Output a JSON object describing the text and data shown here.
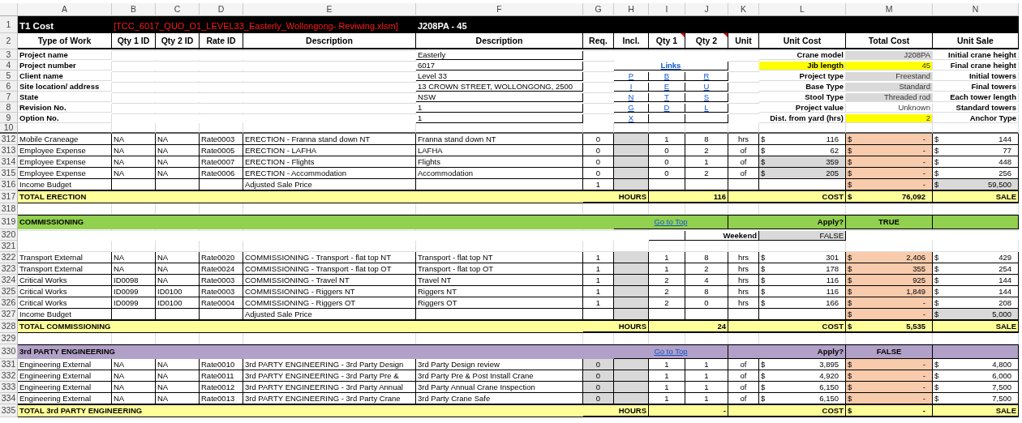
{
  "column_headers": [
    "A",
    "B",
    "C",
    "D",
    "E",
    "F",
    "G",
    "H",
    "I",
    "J",
    "K",
    "L",
    "M",
    "N"
  ],
  "title_row": {
    "row": "1",
    "label": "T1 Cost",
    "file": "[TCC_6017_QUO_O1_LEVEL33_Easterly_Wollongong- Reviwing.xlsm]",
    "model": "J208PA - 45"
  },
  "heading_row": {
    "row": "2",
    "headings": [
      {
        "text": "Type of Work",
        "comment": false
      },
      {
        "text": "Qty 1 ID",
        "comment": false
      },
      {
        "text": "Qty 2 ID",
        "comment": false
      },
      {
        "text": "Rate ID",
        "comment": false
      },
      {
        "text": "Description",
        "comment": false
      },
      {
        "text": "Description",
        "comment": false
      },
      {
        "text": "Req.",
        "comment": false
      },
      {
        "text": "Incl.",
        "comment": false
      },
      {
        "text": "Qty 1",
        "comment": true
      },
      {
        "text": "Qty 2",
        "comment": true
      },
      {
        "text": "Unit",
        "comment": false
      },
      {
        "text": "Unit Cost",
        "comment": false
      },
      {
        "text": "Total Cost",
        "comment": false
      },
      {
        "text": "Unit Sale",
        "comment": false
      }
    ]
  },
  "rows": [
    {
      "row": "3",
      "kind": "info",
      "label": "Project name",
      "value": "Easterly",
      "setting": "Crane model",
      "setting_highlight": false,
      "setting_value": "J208PA",
      "value_highlight": false,
      "value_locked": true,
      "tower": "Initial crane height"
    },
    {
      "row": "4",
      "kind": "info",
      "label": "Project number",
      "value": "6017",
      "links_heading": "Links",
      "setting": "Jib length",
      "setting_highlight": true,
      "setting_value": "45",
      "value_highlight": true,
      "value_locked": false,
      "tower": "Final crane height"
    },
    {
      "row": "5",
      "kind": "info",
      "label": "Client name",
      "value": "Level 33",
      "links": [
        "P",
        "B",
        "R"
      ],
      "setting": "Project type",
      "setting_highlight": false,
      "setting_value": "Freestand",
      "value_highlight": false,
      "value_locked": true,
      "tower": "Initial towers"
    },
    {
      "row": "6",
      "kind": "info",
      "label": "Site location/ address",
      "value": "13 CROWN STREET, WOLLONGONG, 2500",
      "links": [
        "I",
        "E",
        "U"
      ],
      "setting": "Base Type",
      "setting_highlight": false,
      "setting_value": "Standard",
      "value_highlight": false,
      "value_locked": true,
      "tower": "Final towers"
    },
    {
      "row": "7",
      "kind": "info",
      "label": "State",
      "value": "NSW",
      "links": [
        "N",
        "T",
        "S"
      ],
      "setting": "Stool Type",
      "setting_highlight": false,
      "setting_value": "Threaded rod",
      "value_highlight": false,
      "value_locked": true,
      "tower": "Each tower length"
    },
    {
      "row": "8",
      "kind": "info",
      "label": "Revision No.",
      "value": "1",
      "links": [
        "G",
        "D",
        "L"
      ],
      "setting": "Project value",
      "setting_highlight": false,
      "setting_value": "Unknown",
      "value_highlight": false,
      "value_locked": false,
      "tower": "Standard towers"
    },
    {
      "row": "9",
      "kind": "info",
      "label": "Option No.",
      "value": "1",
      "links": [
        "X"
      ],
      "setting": "Dist. from yard (hrs)",
      "setting_highlight": false,
      "setting_value": "2",
      "value_highlight": true,
      "value_locked": false,
      "tower": "Anchor Type"
    },
    {
      "row": "10",
      "kind": "freeze"
    },
    {
      "row": "312",
      "kind": "data",
      "type": "Mobile Craneage",
      "qty1_id": "NA",
      "qty2_id": "NA",
      "rate_id": "Rate0003",
      "description": "ERECTION - Franna stand down NT",
      "detail": "Franna stand down NT",
      "req": "0",
      "req_shaded": false,
      "qty1": "1",
      "qty2": "8",
      "unit": "hrs",
      "unit_cost": {
        "currency": "$",
        "amount": "116",
        "shaded": false
      },
      "total_cost": {
        "currency": "$",
        "amount": "-"
      },
      "unit_sale": {
        "currency": "$",
        "amount": "144",
        "shaded": false
      }
    },
    {
      "row": "313",
      "kind": "data",
      "type": "Employee Expense",
      "qty1_id": "NA",
      "qty2_id": "NA",
      "rate_id": "Rate0005",
      "description": "ERECTION - LAFHA",
      "detail": "LAFHA",
      "req": "0",
      "req_shaded": false,
      "qty1": "0",
      "qty2": "2",
      "unit": "of",
      "unit_cost": {
        "currency": "$",
        "amount": "62",
        "shaded": false
      },
      "total_cost": {
        "currency": "$",
        "amount": "-"
      },
      "unit_sale": {
        "currency": "$",
        "amount": "77",
        "shaded": false
      }
    },
    {
      "row": "314",
      "kind": "data",
      "type": "Employee Expense",
      "qty1_id": "NA",
      "qty2_id": "NA",
      "rate_id": "Rate0007",
      "description": "ERECTION - Flights",
      "detail": "Flights",
      "req": "0",
      "req_shaded": false,
      "qty1": "0",
      "qty2": "1",
      "unit": "of",
      "unit_cost": {
        "currency": "$",
        "amount": "359",
        "shaded": true
      },
      "total_cost": {
        "currency": "$",
        "amount": "-"
      },
      "unit_sale": {
        "currency": "$",
        "amount": "448",
        "shaded": false
      }
    },
    {
      "row": "315",
      "kind": "data",
      "type": "Employee Expense",
      "qty1_id": "NA",
      "qty2_id": "NA",
      "rate_id": "Rate0006",
      "description": "ERECTION - Accommodation",
      "detail": "Accommodation",
      "req": "0",
      "req_shaded": false,
      "qty1": "0",
      "qty2": "2",
      "unit": "of",
      "unit_cost": {
        "currency": "$",
        "amount": "205",
        "shaded": true
      },
      "total_cost": {
        "currency": "$",
        "amount": "-"
      },
      "unit_sale": {
        "currency": "$",
        "amount": "256",
        "shaded": false
      }
    },
    {
      "row": "316",
      "kind": "income",
      "type": "Income Budget",
      "description": "Adjusted Sale Price",
      "req": "1",
      "total_cost": {
        "currency": "$",
        "amount": "-"
      },
      "unit_sale": {
        "currency": "$",
        "amount": "59,500",
        "shaded": true
      }
    },
    {
      "row": "317",
      "kind": "total",
      "label": "TOTAL ERECTION",
      "hours_label": "HOURS",
      "hours": "116",
      "cost_label": "COST",
      "total_cost": {
        "currency": "$",
        "amount": "76,092"
      },
      "sale_label": "SALE"
    },
    {
      "row": "318",
      "kind": "blank"
    },
    {
      "row": "319",
      "kind": "section",
      "label": "COMMISSIONING",
      "color": "#92d050",
      "link": "Go to Top",
      "apply_label": "Apply?",
      "apply_value": "TRUE"
    },
    {
      "row": "320",
      "kind": "weekend",
      "label": "Weekend",
      "value": "FALSE"
    },
    {
      "row": "321",
      "kind": "blank"
    },
    {
      "row": "322",
      "kind": "data",
      "type": "Transport External",
      "qty1_id": "NA",
      "qty2_id": "NA",
      "rate_id": "Rate0020",
      "description": "COMMISSIONING - Transport - flat top NT",
      "detail": "Transport - flat top NT",
      "req": "1",
      "req_shaded": false,
      "qty1": "1",
      "qty2": "8",
      "unit": "hrs",
      "unit_cost": {
        "currency": "$",
        "amount": "301",
        "shaded": false
      },
      "total_cost": {
        "currency": "$",
        "amount": "2,406"
      },
      "unit_sale": {
        "currency": "$",
        "amount": "429",
        "shaded": false
      }
    },
    {
      "row": "323",
      "kind": "data",
      "type": "Transport External",
      "qty1_id": "NA",
      "qty2_id": "NA",
      "rate_id": "Rate0024",
      "description": "COMMISSIONING - Transport - flat top OT",
      "detail": "Transport - flat top OT",
      "req": "1",
      "req_shaded": false,
      "qty1": "1",
      "qty2": "2",
      "unit": "hrs",
      "unit_cost": {
        "currency": "$",
        "amount": "178",
        "shaded": false
      },
      "total_cost": {
        "currency": "$",
        "amount": "355"
      },
      "unit_sale": {
        "currency": "$",
        "amount": "254",
        "shaded": false
      }
    },
    {
      "row": "324",
      "kind": "data",
      "type": "Critical Works",
      "qty1_id": "ID0098",
      "qty2_id": "NA",
      "rate_id": "Rate0003",
      "description": "COMMISSIONING - Travel NT",
      "detail": "Travel NT",
      "req": "1",
      "req_shaded": false,
      "qty1": "2",
      "qty2": "4",
      "unit": "hrs",
      "unit_cost": {
        "currency": "$",
        "amount": "116",
        "shaded": false
      },
      "total_cost": {
        "currency": "$",
        "amount": "925"
      },
      "unit_sale": {
        "currency": "$",
        "amount": "144",
        "shaded": false
      }
    },
    {
      "row": "325",
      "kind": "data",
      "type": "Critical Works",
      "qty1_id": "ID0099",
      "qty2_id": "ID0100",
      "rate_id": "Rate0003",
      "description": "COMMISSIONING - Riggers NT",
      "detail": "Riggers NT",
      "req": "1",
      "req_shaded": false,
      "qty1": "2",
      "qty2": "8",
      "unit": "hrs",
      "unit_cost": {
        "currency": "$",
        "amount": "116",
        "shaded": false
      },
      "total_cost": {
        "currency": "$",
        "amount": "1,849"
      },
      "unit_sale": {
        "currency": "$",
        "amount": "144",
        "shaded": false
      }
    },
    {
      "row": "326",
      "kind": "data",
      "type": "Critical Works",
      "qty1_id": "ID0099",
      "qty2_id": "ID0100",
      "rate_id": "Rate0004",
      "description": "COMMISSIONING - Riggers OT",
      "detail": "Riggers OT",
      "req": "1",
      "req_shaded": false,
      "qty1": "2",
      "qty2": "0",
      "unit": "hrs",
      "unit_cost": {
        "currency": "$",
        "amount": "166",
        "shaded": false
      },
      "total_cost": {
        "currency": "$",
        "amount": "-"
      },
      "unit_sale": {
        "currency": "$",
        "amount": "208",
        "shaded": false
      }
    },
    {
      "row": "327",
      "kind": "income",
      "type": "Income Budget",
      "description": "Adjusted Sale Price",
      "total_cost": {
        "currency": "$",
        "amount": "-"
      },
      "unit_sale": {
        "currency": "$",
        "amount": "5,000",
        "shaded": true
      }
    },
    {
      "row": "328",
      "kind": "total",
      "label": "TOTAL COMMISSIONING",
      "hours_label": "HOURS",
      "hours": "24",
      "cost_label": "COST",
      "total_cost": {
        "currency": "$",
        "amount": "5,535"
      },
      "sale_label": "SALE"
    },
    {
      "row": "329",
      "kind": "blank"
    },
    {
      "row": "330",
      "kind": "section",
      "label": "3rd PARTY ENGINEERING",
      "color": "#b1a0c7",
      "link": "Go to Top",
      "apply_label": "Apply?",
      "apply_value": "FALSE"
    },
    {
      "row": "331",
      "kind": "data",
      "type": "Engineering External",
      "qty1_id": "NA",
      "qty2_id": "NA",
      "rate_id": "Rate0010",
      "description": "3rd PARTY ENGINEERING - 3rd Party Design",
      "detail": "3rd Party Design review",
      "req": "0",
      "req_shaded": true,
      "qty1": "1",
      "qty2": "1",
      "unit": "of",
      "unit_cost": {
        "currency": "$",
        "amount": "3,895",
        "shaded": false
      },
      "total_cost": {
        "currency": "$",
        "amount": "-"
      },
      "unit_sale": {
        "currency": "$",
        "amount": "4,800",
        "shaded": false
      }
    },
    {
      "row": "332",
      "kind": "data",
      "type": "Engineering External",
      "qty1_id": "NA",
      "qty2_id": "NA",
      "rate_id": "Rate0011",
      "description": "3rd PARTY ENGINEERING - 3rd Party Pre &",
      "detail": "3rd Party Pre & Post Install Crane",
      "req": "0",
      "req_shaded": true,
      "qty1": "1",
      "qty2": "1",
      "unit": "of",
      "unit_cost": {
        "currency": "$",
        "amount": "4,920",
        "shaded": false
      },
      "total_cost": {
        "currency": "$",
        "amount": "-"
      },
      "unit_sale": {
        "currency": "$",
        "amount": "6,000",
        "shaded": false
      }
    },
    {
      "row": "333",
      "kind": "data",
      "type": "Engineering External",
      "qty1_id": "NA",
      "qty2_id": "NA",
      "rate_id": "Rate0012",
      "description": "3rd PARTY ENGINEERING - 3rd Party Annual",
      "detail": "3rd Party Annual Crane Inspection",
      "req": "0",
      "req_shaded": true,
      "qty1": "1",
      "qty2": "1",
      "unit": "of",
      "unit_cost": {
        "currency": "$",
        "amount": "6,150",
        "shaded": false
      },
      "total_cost": {
        "currency": "$",
        "amount": "-"
      },
      "unit_sale": {
        "currency": "$",
        "amount": "7,500",
        "shaded": false
      }
    },
    {
      "row": "334",
      "kind": "data",
      "type": "Engineering External",
      "qty1_id": "NA",
      "qty2_id": "NA",
      "rate_id": "Rate0013",
      "description": "3rd PARTY ENGINEERING - 3rd Party Crane",
      "detail": "3rd Party Crane Safe",
      "req": "0",
      "req_shaded": true,
      "qty1": "1",
      "qty2": "1",
      "unit": "of",
      "unit_cost": {
        "currency": "$",
        "amount": "6,150",
        "shaded": false
      },
      "total_cost": {
        "currency": "$",
        "amount": "-"
      },
      "unit_sale": {
        "currency": "$",
        "amount": "7,500",
        "shaded": false
      }
    },
    {
      "row": "335",
      "kind": "total",
      "label": "TOTAL 3rd PARTY ENGINEERING",
      "hours_label": "HOURS",
      "hours": "-",
      "cost_label": "COST",
      "total_cost": {
        "currency": "$",
        "amount": "-"
      },
      "sale_label": "SALE"
    }
  ]
}
